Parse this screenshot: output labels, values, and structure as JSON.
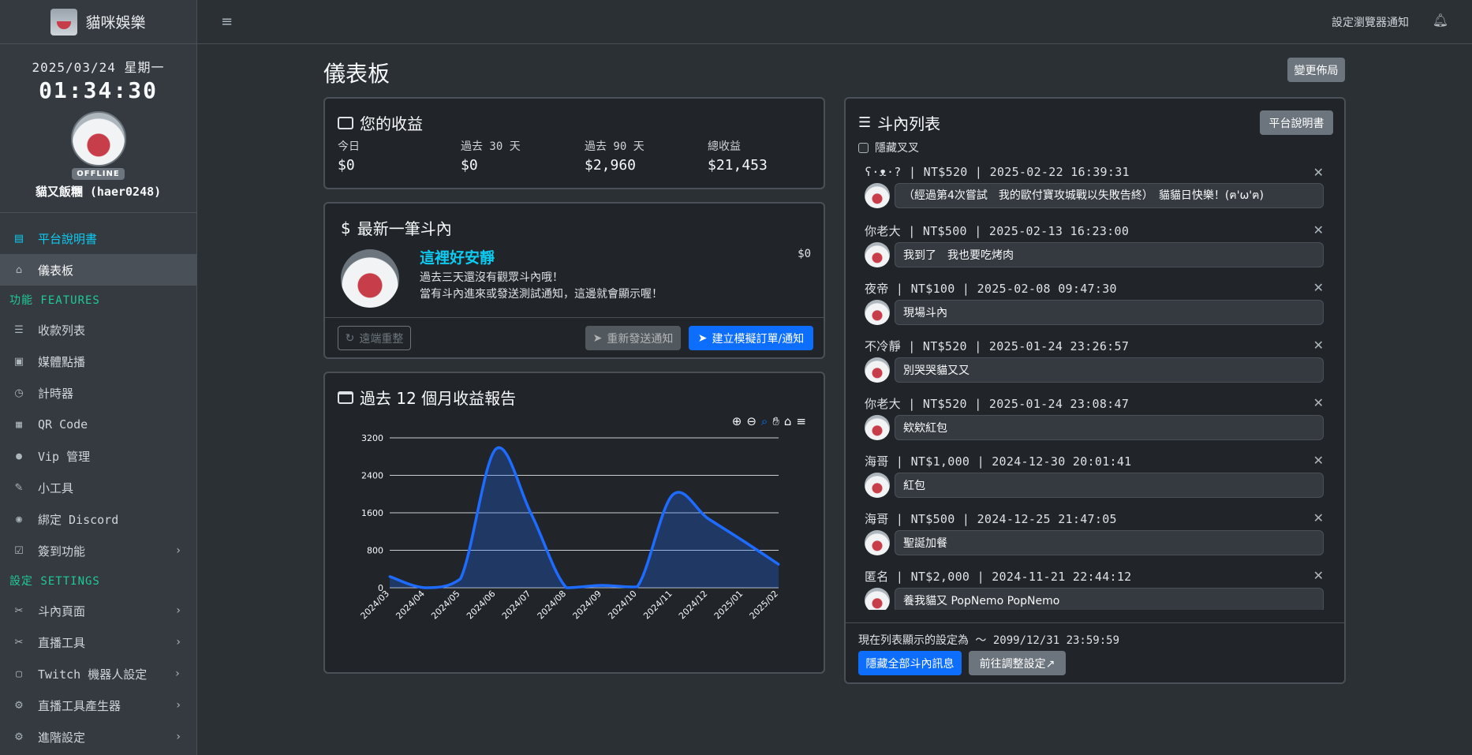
{
  "brand": {
    "name": "貓咪娛樂"
  },
  "clock": {
    "date": "2025/03/24 星期一",
    "time": "01:34:30"
  },
  "profile": {
    "status": "OFFLINE",
    "name": "貓又飯糰 (haer0248)"
  },
  "sidebar": {
    "items": [
      {
        "label": "平台說明書",
        "icon": "document-icon"
      },
      {
        "label": "儀表板",
        "icon": "home-icon"
      }
    ],
    "features_heading": "功能 FEATURES",
    "features": [
      {
        "label": "收款列表",
        "icon": "list-icon"
      },
      {
        "label": "媒體點播",
        "icon": "media-icon"
      },
      {
        "label": "計時器",
        "icon": "timer-icon"
      },
      {
        "label": "QR Code",
        "icon": "qrcode-icon"
      },
      {
        "label": "Vip 管理",
        "icon": "user-plus-icon"
      },
      {
        "label": "小工具",
        "icon": "wrench-icon"
      },
      {
        "label": "綁定 Discord",
        "icon": "discord-icon"
      },
      {
        "label": "簽到功能",
        "icon": "checkbox-icon"
      }
    ],
    "settings_heading": "設定 SETTINGS",
    "settings": [
      {
        "label": "斗內頁面",
        "icon": "tools-icon"
      },
      {
        "label": "直播工具",
        "icon": "tools-icon"
      },
      {
        "label": "Twitch 機器人設定",
        "icon": "twitch-icon"
      },
      {
        "label": "直播工具產生器",
        "icon": "gear-icon"
      },
      {
        "label": "進階設定",
        "icon": "gear-icon"
      }
    ]
  },
  "topbar": {
    "notify_label": "設定瀏覽器通知"
  },
  "page": {
    "title": "儀表板",
    "layout_button": "變更佈局"
  },
  "earnings": {
    "title": "您的收益",
    "stats": [
      {
        "label": "今日",
        "value": "$0"
      },
      {
        "label": "過去 30 天",
        "value": "$0"
      },
      {
        "label": "過去 90 天",
        "value": "$2,960"
      },
      {
        "label": "總收益",
        "value": "$21,453"
      }
    ]
  },
  "latest": {
    "title": "最新一筆斗內",
    "headline": "這裡好安靜",
    "amount": "$0",
    "line1": "過去三天還沒有觀眾斗內哦！",
    "line2": "當有斗內進來或發送測試通知，這邊就會顯示喔！",
    "reset_button": "遠端重整",
    "resend_button": "重新發送通知",
    "mock_button": "建立模擬訂單/通知"
  },
  "report": {
    "title": "過去 12 個月收益報告"
  },
  "chart_data": {
    "type": "area",
    "categories": [
      "2024/03",
      "2024/04",
      "2024/05",
      "2024/06",
      "2024/07",
      "2024/08",
      "2024/09",
      "2024/10",
      "2024/11",
      "2024/12",
      "2025/01",
      "2025/02"
    ],
    "values": [
      240,
      0,
      190,
      2960,
      1580,
      0,
      50,
      20,
      1980,
      1480,
      1000,
      500
    ],
    "yticks": [
      "0",
      "800",
      "1600",
      "2400",
      "3200"
    ],
    "ylim": [
      0,
      3200
    ],
    "color": "#1e6bff",
    "grid": true
  },
  "donations": {
    "title": "斗內列表",
    "guide_button": "平台說明書",
    "hide_label": "隱藏叉叉",
    "items": [
      {
        "meta": "ʕ·ᴥ·? | NT$520 | 2025-02-22 16:39:31",
        "message": "（經過第4次嘗試　我的歐付寶攻城戰以失敗告終）　貓貓日快樂！(ฅ'ω'ฅ)"
      },
      {
        "meta": "你老大 | NT$500 | 2025-02-13 16:23:00",
        "message": "我到了　我也要吃烤肉"
      },
      {
        "meta": "夜帝 | NT$100 | 2025-02-08 09:47:30",
        "message": "現場斗內"
      },
      {
        "meta": "不冷靜 | NT$520 | 2025-01-24 23:26:57",
        "message": "別哭哭貓又又"
      },
      {
        "meta": "你老大 | NT$520 | 2025-01-24 23:08:47",
        "message": "欸欸紅包"
      },
      {
        "meta": "海哥 | NT$1,000 | 2024-12-30 20:01:41",
        "message": "紅包"
      },
      {
        "meta": "海哥 | NT$500 | 2024-12-25 21:47:05",
        "message": "聖誕加餐"
      },
      {
        "meta": "匿名 | NT$2,000 | 2024-11-21 22:44:12",
        "message": "養我貓又 PopNemo PopNemo"
      }
    ],
    "footer_text": "現在列表顯示的設定為 ～ 2099/12/31 23:59:59",
    "hide_all_button": "隱藏全部斗內訊息",
    "goto_button": "前往調整設定↗"
  }
}
